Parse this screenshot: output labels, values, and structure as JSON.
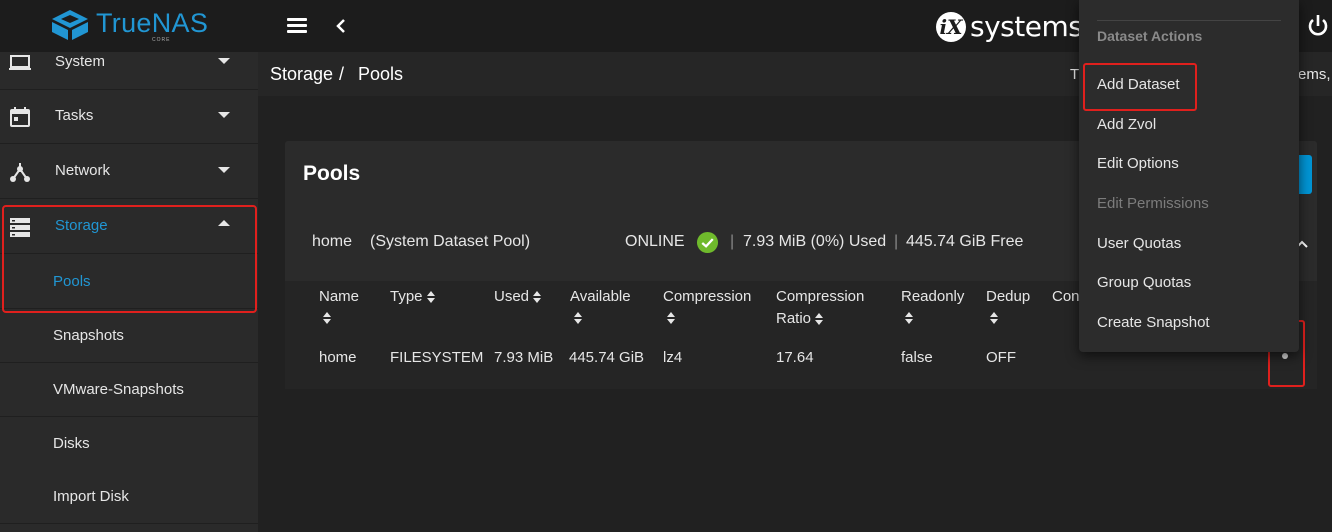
{
  "app": {
    "logo_text": "TrueNAS",
    "logo_sub": "CORE",
    "vendor_ix": "iX",
    "vendor_text": "systems"
  },
  "colors": {
    "accent": "#2196d3",
    "highlight": "#e0201d",
    "status_ok": "#6fba2c",
    "topbar": "#1c1c1c",
    "sidebar": "#2a2a2a"
  },
  "sidebar": {
    "items": [
      {
        "label": "System",
        "icon": "laptop-icon"
      },
      {
        "label": "Tasks",
        "icon": "calendar-icon"
      },
      {
        "label": "Network",
        "icon": "network-icon"
      },
      {
        "label": "Storage",
        "icon": "storage-icon"
      }
    ],
    "subitems": [
      {
        "label": "Pools"
      },
      {
        "label": "Snapshots"
      },
      {
        "label": "VMware-Snapshots"
      },
      {
        "label": "Disks"
      },
      {
        "label": "Import Disk"
      }
    ]
  },
  "breadcrumb": {
    "section": "Storage",
    "separator": "/",
    "page": "Pools",
    "right_left": "T",
    "right_right": "ems, |"
  },
  "card": {
    "title": "Pools"
  },
  "pool": {
    "name": "home",
    "description": "(System Dataset Pool)",
    "status": "ONLINE",
    "separator": "|",
    "used": "7.93 MiB (0%) Used",
    "free": "445.74 GiB Free"
  },
  "table": {
    "headers": [
      "Name",
      "Type",
      "Used",
      "Available",
      "Compression",
      "Compression Ratio",
      "Readonly",
      "Dedup",
      "Con"
    ],
    "rows": [
      [
        "home",
        "FILESYSTEM",
        "7.93 MiB",
        "445.74 GiB",
        "lz4",
        "17.64",
        "false",
        "OFF"
      ]
    ]
  },
  "menu": {
    "header": "Dataset Actions",
    "items": [
      {
        "label": "Add Dataset",
        "disabled": false
      },
      {
        "label": "Add Zvol",
        "disabled": false
      },
      {
        "label": "Edit Options",
        "disabled": false
      },
      {
        "label": "Edit Permissions",
        "disabled": true
      },
      {
        "label": "User Quotas",
        "disabled": false
      },
      {
        "label": "Group Quotas",
        "disabled": false
      },
      {
        "label": "Create Snapshot",
        "disabled": false
      }
    ]
  }
}
